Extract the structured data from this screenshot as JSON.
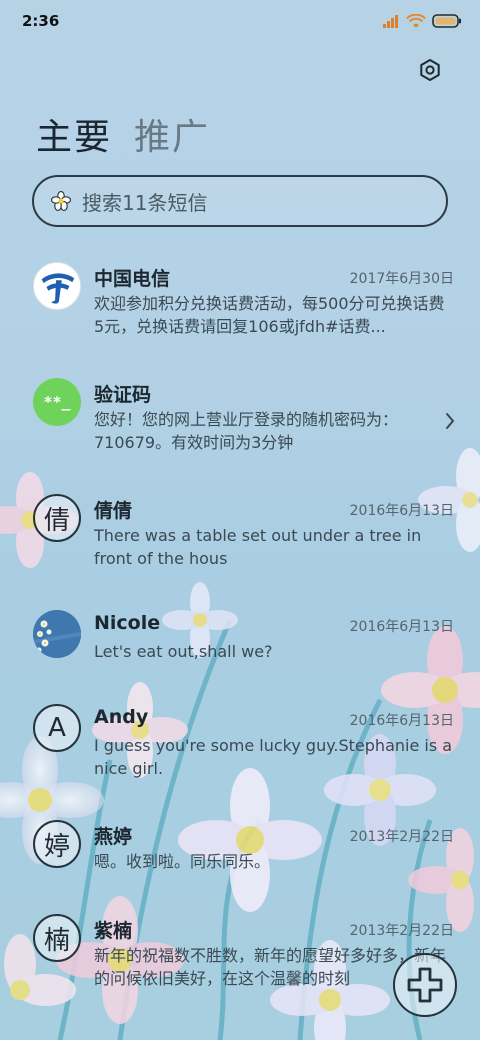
{
  "status_bar": {
    "time": "2:36",
    "icons": [
      "signal-icon",
      "wifi-icon",
      "battery-icon"
    ],
    "battery_color": "#e8b36b"
  },
  "header": {
    "settings_icon": "gear-icon",
    "tabs": [
      {
        "label": "主要",
        "active": true
      },
      {
        "label": "推广",
        "active": false
      }
    ]
  },
  "search": {
    "placeholder": "搜索11条短信",
    "icon": "flower-search-icon"
  },
  "messages": [
    {
      "name": "中国电信",
      "date": "2017年6月30日",
      "preview": "欢迎参加积分兑换话费活动，每500分可兑换话费5元，兑换话费请回复106或jfdh#话费...",
      "avatar_type": "logo",
      "avatar_icon": "china-telecom-logo"
    },
    {
      "name": "验证码",
      "date": "",
      "preview": "您好！您的网上营业厅登录的随机密码为：710679。有效时间为3分钟",
      "avatar_type": "badge",
      "avatar_text": "**_",
      "avatar_color": "#6fd35b"
    },
    {
      "name": "倩倩",
      "date": "2016年6月13日",
      "preview": "There was a table set out under a tree in front of the hous",
      "avatar_type": "letter",
      "avatar_text": "倩"
    },
    {
      "name": "Nicole",
      "date": "2016年6月13日",
      "preview": "Let's eat out,shall we?",
      "avatar_type": "photo",
      "avatar_icon": "flower-photo-avatar"
    },
    {
      "name": "Andy",
      "date": "2016年6月13日",
      "preview": "I guess you're some lucky guy.Stephanie is a nice girl.",
      "avatar_type": "letter",
      "avatar_text": "A"
    },
    {
      "name": "燕婷",
      "date": "2013年2月22日",
      "preview": "嗯。收到啦。同乐同乐。",
      "avatar_type": "letter",
      "avatar_text": "婷"
    },
    {
      "name": "紫楠",
      "date": "2013年2月22日",
      "preview": "新年的祝福数不胜数，新年的愿望好多好多，新年的问候依旧美好，在这个温馨的时刻",
      "avatar_type": "letter",
      "avatar_text": "楠"
    }
  ],
  "fab": {
    "icon": "compose-plus-icon"
  }
}
